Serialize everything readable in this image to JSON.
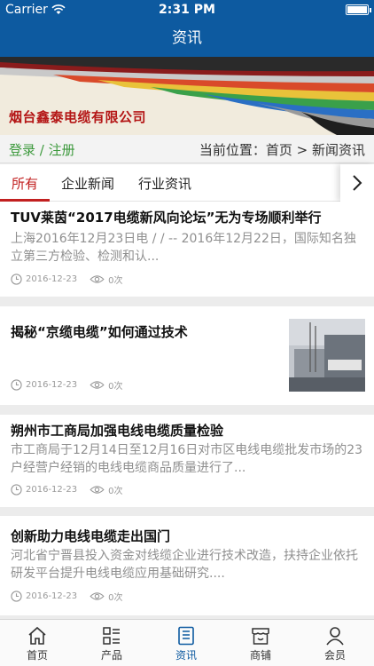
{
  "status_bar": {
    "carrier": "Carrier",
    "time": "2:31 PM"
  },
  "nav": {
    "title": "资讯"
  },
  "banner": {
    "company_name": "烟台鑫泰电缆有限公司"
  },
  "account": {
    "login": "登录",
    "separator": " / ",
    "register": "注册"
  },
  "breadcrumb": {
    "prefix": "当前位置：",
    "home": "首页",
    "arrow": " > ",
    "current": "新闻资讯"
  },
  "tabs": [
    {
      "label": "所有",
      "active": true
    },
    {
      "label": "企业新闻",
      "active": false
    },
    {
      "label": "行业资讯",
      "active": false
    }
  ],
  "news": [
    {
      "title": "TUV莱茵“2017电缆新风向论坛”无为专场顺利举行",
      "summary": "上海2016年12月23日电 / / -- 2016年12月22日，国际知名独立第三方检验、检测和认...",
      "date": "2016-12-23",
      "views": "0次"
    },
    {
      "title": "揭秘“京缆电缆”如何通过技术",
      "summary": "",
      "date": "2016-12-23",
      "views": "0次"
    },
    {
      "title": "朔州市工商局加强电线电缆质量检验",
      "summary": "市工商局于12月14日至12月16日对市区电线电缆批发市场的23户经营户经销的电线电缆商品质量进行了...",
      "date": "2016-12-23",
      "views": "0次"
    },
    {
      "title": "创新助力电线电缆走出国门",
      "summary": " 河北省宁晋县投入资金对线缆企业进行技术改造，扶持企业依托研发平台提升电线电缆应用基础研究....",
      "date": "2016-12-23",
      "views": "0次"
    }
  ],
  "tab_bar": [
    {
      "label": "首页",
      "icon": "home-icon",
      "active": false
    },
    {
      "label": "产品",
      "icon": "product-grid-icon",
      "active": false
    },
    {
      "label": "资讯",
      "icon": "news-icon",
      "active": true
    },
    {
      "label": "商铺",
      "icon": "store-icon",
      "active": false
    },
    {
      "label": "会员",
      "icon": "member-icon",
      "active": false
    }
  ],
  "colors": {
    "primary": "#0d5aa0",
    "accent_red": "#c22020",
    "green": "#3e9a3e"
  }
}
